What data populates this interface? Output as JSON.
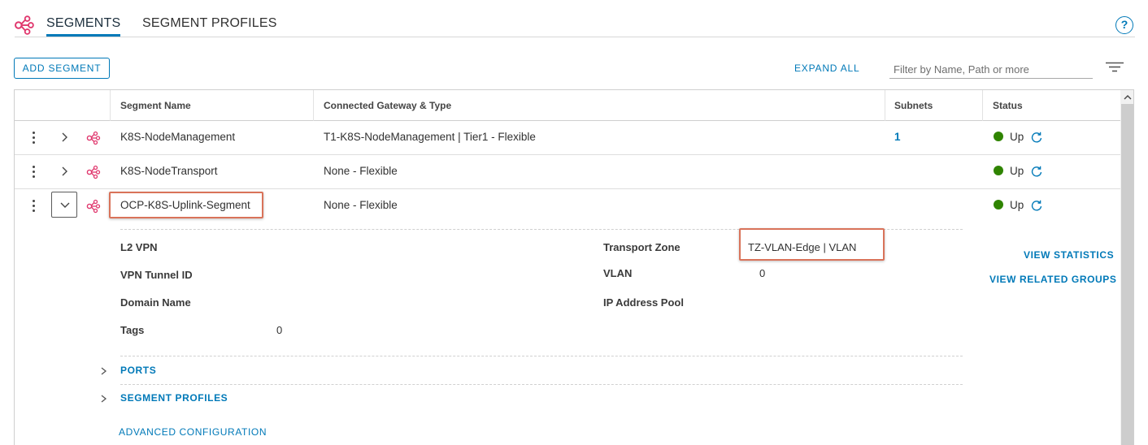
{
  "tabs": [
    {
      "label": "SEGMENTS",
      "active": true
    },
    {
      "label": "SEGMENT PROFILES",
      "active": false
    }
  ],
  "help_label": "?",
  "toolbar": {
    "add_segment": "ADD SEGMENT",
    "expand_all": "EXPAND ALL",
    "filter_placeholder": "Filter by Name, Path or more"
  },
  "columns": {
    "name": "Segment Name",
    "gateway": "Connected Gateway & Type",
    "subnets": "Subnets",
    "status": "Status"
  },
  "rows": [
    {
      "name": "K8S-NodeManagement",
      "gateway": "T1-K8S-NodeManagement | Tier1 - Flexible",
      "subnets": "1",
      "status": "Up"
    },
    {
      "name": "K8S-NodeTransport",
      "gateway": "None - Flexible",
      "subnets": "",
      "status": "Up"
    },
    {
      "name": "OCP-K8S-Uplink-Segment",
      "gateway": "None - Flexible",
      "subnets": "",
      "status": "Up"
    }
  ],
  "details": {
    "l2vpn_label": "L2 VPN",
    "vpn_tunnel_label": "VPN Tunnel ID",
    "domain_label": "Domain Name",
    "tags_label": "Tags",
    "tags_value": "0",
    "transport_zone_label": "Transport Zone",
    "transport_zone_value": "TZ-VLAN-Edge | VLAN",
    "vlan_label": "VLAN",
    "vlan_value": "0",
    "ip_pool_label": "IP Address Pool",
    "view_statistics": "VIEW STATISTICS",
    "view_related_groups": "VIEW RELATED GROUPS",
    "ports": "PORTS",
    "segment_profiles": "SEGMENT PROFILES",
    "advanced_configuration": "ADVANCED CONFIGURATION"
  },
  "colors": {
    "accent": "#0079b8",
    "segment_icon": "#e0386e",
    "status_up": "#2f8400",
    "highlight": "#d9735a"
  },
  "icons": {
    "segments_tab": "segment-network-icon",
    "row": "segment-network-icon",
    "filter": "filter-lines-icon",
    "refresh": "refresh-icon",
    "expand": "chevron-right-icon",
    "collapse": "chevron-down-icon",
    "actions": "kebab-menu-icon",
    "help": "help-circle-icon"
  }
}
